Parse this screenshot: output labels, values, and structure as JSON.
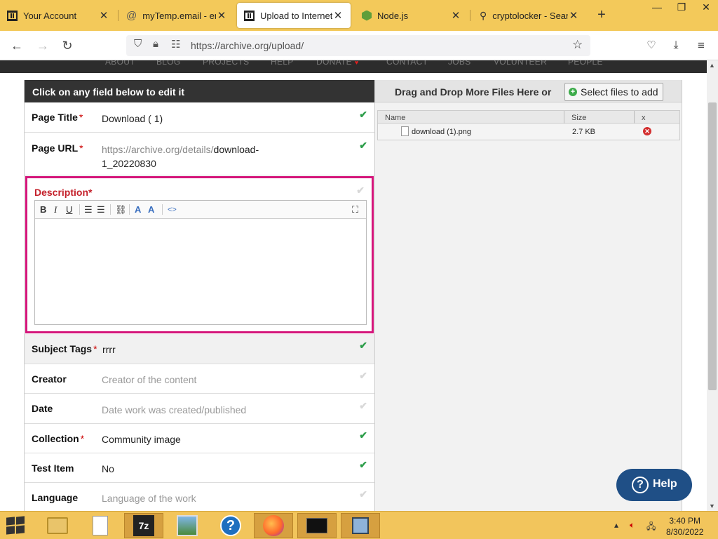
{
  "browser": {
    "tabs": [
      {
        "label": "Your Account",
        "icon": "archive-pillar-icon",
        "active": false
      },
      {
        "label": "myTemp.email - email",
        "icon": "at-sign-icon",
        "active": false
      },
      {
        "label": "Upload to Internet Archive",
        "icon": "archive-pillar-icon",
        "active": true
      },
      {
        "label": "Node.js",
        "icon": "nodejs-hexagon-icon",
        "active": false
      },
      {
        "label": "cryptolocker - Search",
        "icon": "search-icon",
        "active": false
      }
    ],
    "new_tab": "+",
    "window_controls": {
      "minimize": "—",
      "restore": "❐",
      "close": "✕"
    },
    "url": "https://archive.org/upload/",
    "nav": {
      "back": "←",
      "forward": "→",
      "reload": "↻"
    },
    "accent_color": "#f3c95a"
  },
  "site_nav": {
    "links": [
      "ABOUT",
      "BLOG",
      "PROJECTS",
      "HELP",
      "DONATE",
      "CONTACT",
      "JOBS",
      "VOLUNTEER",
      "PEOPLE"
    ]
  },
  "form": {
    "header": "Click on any field below to edit it",
    "page_title": {
      "label": "Page Title",
      "value": "Download ( 1)"
    },
    "page_url": {
      "label": "Page URL",
      "prefix": "https://archive.org/details/",
      "value_line1": "download-",
      "value_line2": "1_20220830"
    },
    "description": {
      "label": "Description"
    },
    "subject_tags": {
      "label": "Subject Tags",
      "value": "rrrr"
    },
    "creator": {
      "label": "Creator",
      "placeholder": "Creator of the content"
    },
    "date": {
      "label": "Date",
      "placeholder": "Date work was created/published"
    },
    "collection": {
      "label": "Collection",
      "value": "Community image"
    },
    "test_item": {
      "label": "Test Item",
      "value": "No"
    },
    "language": {
      "label": "Language",
      "placeholder": "Language of the work"
    },
    "required_marker": "*",
    "check_glyph": "✔"
  },
  "editor_toolbar": {
    "bold": "B",
    "italic": "I",
    "underline": "U",
    "source": "<>",
    "fullscreen": "⛶"
  },
  "upload": {
    "drag_text": "Drag and Drop More Files Here or",
    "select_button": "Select files to add",
    "columns": {
      "name": "Name",
      "size": "Size",
      "remove": "x"
    },
    "files": [
      {
        "name": "download (1).png",
        "size": "2.7 KB"
      }
    ]
  },
  "help_button": "Help",
  "taskbar": {
    "apps": [
      "file-explorer",
      "notepad",
      "7-zip",
      "photo-viewer",
      "help-and-support",
      "firefox",
      "command-prompt",
      "network-connections"
    ],
    "sevenzip_label": "7z",
    "help_glyph": "?",
    "time": "3:40 PM",
    "date": "8/30/2022"
  }
}
